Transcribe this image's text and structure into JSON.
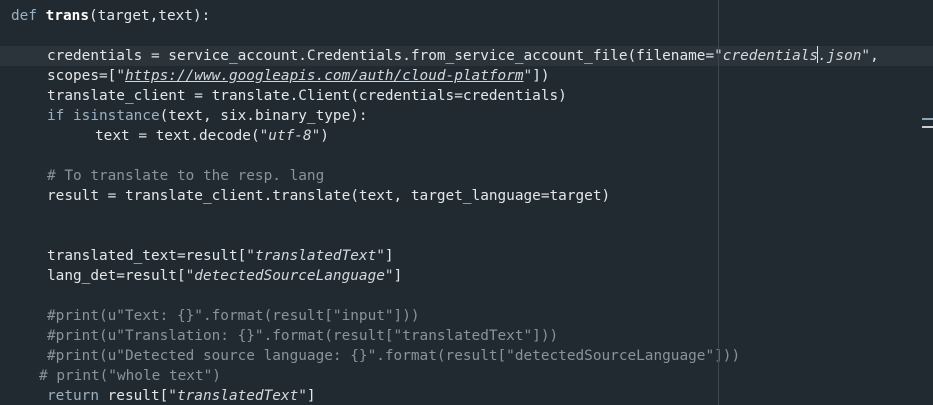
{
  "editor": {
    "colors": {
      "background": "#222a31",
      "current_line": "#2b343b",
      "text": "#e3e7ea",
      "keyword": "#9ab0c4",
      "comment": "#88939c",
      "string": "#d2d8dd"
    },
    "overview_marks": [
      {
        "color": "#8aa4b8"
      },
      {
        "color": "#c9ced2"
      }
    ],
    "lines": [
      {
        "indent": 0,
        "tokens": [
          {
            "t": "def",
            "c": "kw"
          },
          {
            "t": " ",
            "c": "txt"
          },
          {
            "t": "trans",
            "c": "fn-name"
          },
          {
            "t": "(target,text):",
            "c": "txt"
          }
        ]
      },
      {
        "indent": 0,
        "tokens": []
      },
      {
        "indent": 4,
        "current": true,
        "tokens": [
          {
            "t": "credentials = service_account.Credentials.from_service_account_file(filename=",
            "c": "txt"
          },
          {
            "t": "\"credentials",
            "c": "str"
          },
          {
            "cursor": true
          },
          {
            "t": ".json\"",
            "c": "str"
          },
          {
            "t": ",",
            "c": "txt"
          }
        ]
      },
      {
        "indent": 4,
        "tokens": [
          {
            "t": "scopes=[",
            "c": "txt"
          },
          {
            "t": "\"",
            "c": "str"
          },
          {
            "t": "https://www.googleapis.com/auth/cloud-platform",
            "c": "str url"
          },
          {
            "t": "\"",
            "c": "str"
          },
          {
            "t": "])",
            "c": "txt"
          }
        ]
      },
      {
        "indent": 4,
        "tokens": [
          {
            "t": "translate_client = translate.Client(credentials=credentials)",
            "c": "txt"
          }
        ]
      },
      {
        "indent": 4,
        "tokens": [
          {
            "t": "if",
            "c": "kw"
          },
          {
            "t": " ",
            "c": "txt"
          },
          {
            "t": "isinstance",
            "c": "kw"
          },
          {
            "t": "(text, six.binary_type):",
            "c": "txt"
          }
        ]
      },
      {
        "indent": 8,
        "tokens": [
          {
            "t": "text = text.decode(",
            "c": "txt"
          },
          {
            "t": "\"utf-8\"",
            "c": "str"
          },
          {
            "t": ")",
            "c": "txt"
          }
        ]
      },
      {
        "indent": 0,
        "tokens": []
      },
      {
        "indent": 4,
        "tokens": [
          {
            "t": "# To translate to the resp. lang",
            "c": "cm"
          }
        ]
      },
      {
        "indent": 4,
        "tokens": [
          {
            "t": "result = translate_client.translate(text, target_language=target)",
            "c": "txt"
          }
        ]
      },
      {
        "indent": 0,
        "tokens": []
      },
      {
        "indent": 0,
        "tokens": []
      },
      {
        "indent": 4,
        "tokens": [
          {
            "t": "translated_text=result[",
            "c": "txt"
          },
          {
            "t": "\"translatedText\"",
            "c": "str"
          },
          {
            "t": "]",
            "c": "txt"
          }
        ]
      },
      {
        "indent": 4,
        "tokens": [
          {
            "t": "lang_det=result[",
            "c": "txt"
          },
          {
            "t": "\"detectedSourceLanguage\"",
            "c": "str"
          },
          {
            "t": "]",
            "c": "txt"
          }
        ]
      },
      {
        "indent": 0,
        "tokens": []
      },
      {
        "indent": 4,
        "tokens": [
          {
            "t": "#print(u\"Text: {}\".format(result[\"input\"]))",
            "c": "cm"
          }
        ]
      },
      {
        "indent": 4,
        "tokens": [
          {
            "t": "#print(u\"Translation: {}\".format(result[\"translatedText\"]))",
            "c": "cm"
          }
        ]
      },
      {
        "indent": 4,
        "tokens": [
          {
            "t": "#print(u\"Detected source language: {}\".format(result[\"detectedSourceLanguage\"]))",
            "c": "cm"
          }
        ]
      },
      {
        "indent": 3,
        "tokens": [
          {
            "t": "# print(\"whole text\")",
            "c": "cm"
          }
        ]
      },
      {
        "indent": 4,
        "tokens": [
          {
            "t": "return",
            "c": "kw"
          },
          {
            "t": " result[",
            "c": "txt"
          },
          {
            "t": "\"translatedText\"",
            "c": "str"
          },
          {
            "t": "]",
            "c": "txt"
          }
        ]
      }
    ]
  }
}
